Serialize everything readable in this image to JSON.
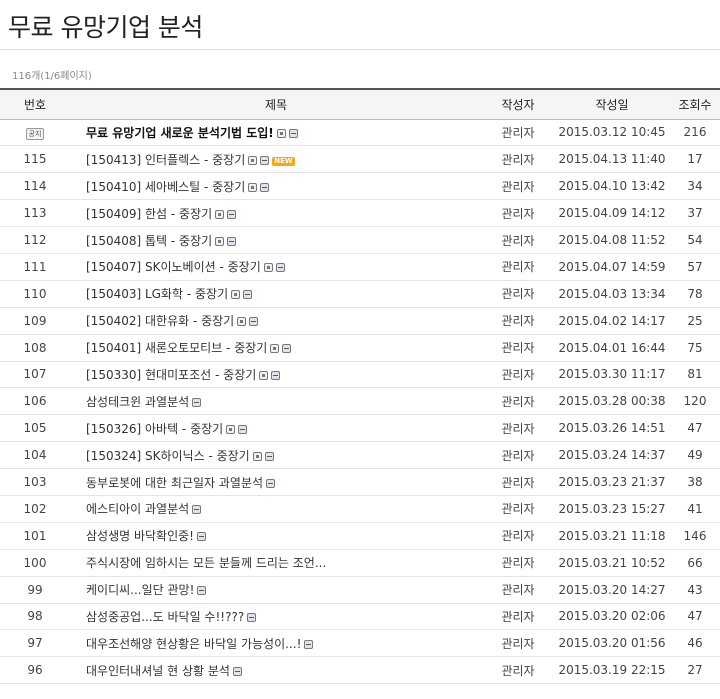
{
  "page_title": "무료 유망기업 분석",
  "count_text": "116개(1/6페이지)",
  "columns": {
    "num": "번호",
    "subject": "제목",
    "author": "작성자",
    "date": "작성일",
    "hits": "조회수"
  },
  "notice_label": "공지",
  "new_label": "NEW",
  "posts": [
    {
      "num": "공지",
      "notice": true,
      "title": "무료 유망기업 새로운 분석기법 도입!",
      "icons": [
        "file",
        "hot"
      ],
      "new": false,
      "author": "관리자",
      "date": "2015.03.12 10:45",
      "hits": "216"
    },
    {
      "num": "115",
      "title": "[150413] 인터플렉스 - 중장기",
      "icons": [
        "file",
        "hot"
      ],
      "new": true,
      "author": "관리자",
      "date": "2015.04.13 11:40",
      "hits": "17"
    },
    {
      "num": "114",
      "title": "[150410] 세아베스틸 - 중장기",
      "icons": [
        "file",
        "hot"
      ],
      "new": false,
      "author": "관리자",
      "date": "2015.04.10 13:42",
      "hits": "34"
    },
    {
      "num": "113",
      "title": "[150409] 한섬 - 중장기",
      "icons": [
        "file",
        "hot"
      ],
      "new": false,
      "author": "관리자",
      "date": "2015.04.09 14:12",
      "hits": "37"
    },
    {
      "num": "112",
      "title": "[150408] 톱텍 - 중장기",
      "icons": [
        "file",
        "hot"
      ],
      "new": false,
      "author": "관리자",
      "date": "2015.04.08 11:52",
      "hits": "54"
    },
    {
      "num": "111",
      "title": "[150407] SK이노베이션 - 중장기",
      "icons": [
        "file",
        "hot"
      ],
      "new": false,
      "author": "관리자",
      "date": "2015.04.07 14:59",
      "hits": "57"
    },
    {
      "num": "110",
      "title": "[150403] LG화학 - 중장기",
      "icons": [
        "file",
        "hot"
      ],
      "new": false,
      "author": "관리자",
      "date": "2015.04.03 13:34",
      "hits": "78"
    },
    {
      "num": "109",
      "title": "[150402] 대한유화 - 중장기",
      "icons": [
        "file",
        "hot"
      ],
      "new": false,
      "author": "관리자",
      "date": "2015.04.02 14:17",
      "hits": "25"
    },
    {
      "num": "108",
      "title": "[150401] 새론오토모티브 - 중장기",
      "icons": [
        "file",
        "hot"
      ],
      "new": false,
      "author": "관리자",
      "date": "2015.04.01 16:44",
      "hits": "75"
    },
    {
      "num": "107",
      "title": "[150330] 현대미포조선 - 중장기",
      "icons": [
        "file",
        "hot"
      ],
      "new": false,
      "author": "관리자",
      "date": "2015.03.30 11:17",
      "hits": "81"
    },
    {
      "num": "106",
      "title": "삼성테크윈 과열분석",
      "icons": [
        "hot"
      ],
      "new": false,
      "author": "관리자",
      "date": "2015.03.28 00:38",
      "hits": "120"
    },
    {
      "num": "105",
      "title": "[150326] 아바텍 - 중장기",
      "icons": [
        "file",
        "hot"
      ],
      "new": false,
      "author": "관리자",
      "date": "2015.03.26 14:51",
      "hits": "47"
    },
    {
      "num": "104",
      "title": "[150324] SK하이닉스 - 중장기",
      "icons": [
        "file",
        "hot"
      ],
      "new": false,
      "author": "관리자",
      "date": "2015.03.24 14:37",
      "hits": "49"
    },
    {
      "num": "103",
      "title": "동부로봇에 대한 최근일자 과열분석",
      "icons": [
        "hot"
      ],
      "new": false,
      "author": "관리자",
      "date": "2015.03.23 21:37",
      "hits": "38"
    },
    {
      "num": "102",
      "title": "에스티아이 과열분석",
      "icons": [
        "hot"
      ],
      "new": false,
      "author": "관리자",
      "date": "2015.03.23 15:27",
      "hits": "41"
    },
    {
      "num": "101",
      "title": "삼성생명 바닥확인중!",
      "icons": [
        "hot"
      ],
      "new": false,
      "author": "관리자",
      "date": "2015.03.21 11:18",
      "hits": "146"
    },
    {
      "num": "100",
      "title": "주식시장에 임하시는 모든 분들께 드리는 조언...",
      "icons": [],
      "new": false,
      "author": "관리자",
      "date": "2015.03.21 10:52",
      "hits": "66"
    },
    {
      "num": "99",
      "title": "케이디씨...일단 관망!",
      "icons": [
        "hot"
      ],
      "new": false,
      "author": "관리자",
      "date": "2015.03.20 14:27",
      "hits": "43"
    },
    {
      "num": "98",
      "title": "삼성중공업...도 바닥일 수!!???",
      "icons": [
        "hot"
      ],
      "new": false,
      "author": "관리자",
      "date": "2015.03.20 02:06",
      "hits": "47"
    },
    {
      "num": "97",
      "title": "대우조선해양 현상황은 바닥일 가능성이...!",
      "icons": [
        "hot"
      ],
      "new": false,
      "author": "관리자",
      "date": "2015.03.20 01:56",
      "hits": "46"
    },
    {
      "num": "96",
      "title": "대우인터내셔널 현 상황 분석",
      "icons": [
        "hot"
      ],
      "new": false,
      "author": "관리자",
      "date": "2015.03.19 22:15",
      "hits": "27"
    }
  ]
}
